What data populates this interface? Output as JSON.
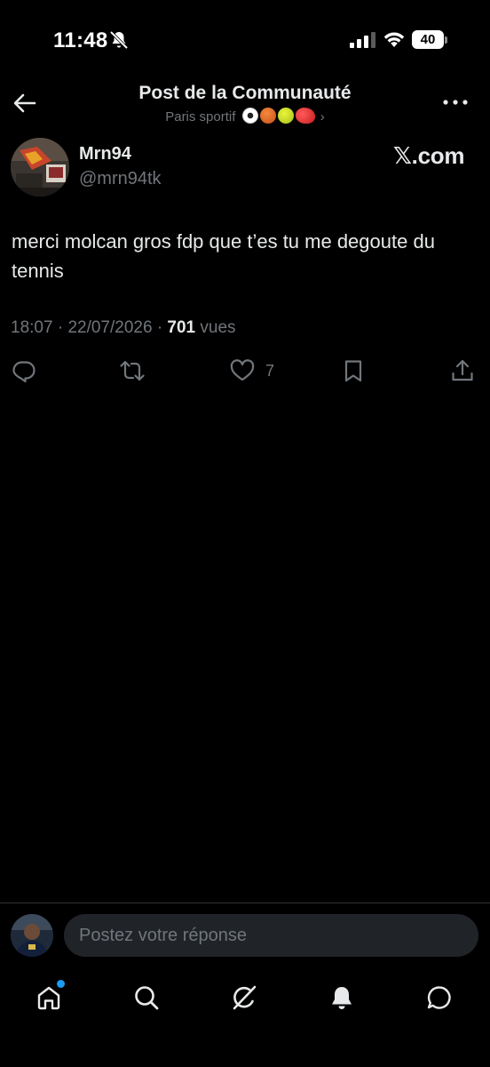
{
  "status_bar": {
    "time": "11:48",
    "battery": "40"
  },
  "header": {
    "title": "Post de la Communauté",
    "subtitle": "Paris sportif",
    "subtitle_emojis": [
      "soccer-ball",
      "basketball",
      "tennis-ball",
      "boxing-glove"
    ],
    "subtitle_chevron": "›"
  },
  "post": {
    "author_name": "Mrn94",
    "author_handle": "@mrn94tk",
    "watermark": "𝕏.com",
    "text": "merci molcan gros fdp que t’es tu me degoute du tennis",
    "time": "18:07",
    "date": "22/07/2026",
    "views_count": "701",
    "views_label": "vues",
    "like_count": "7"
  },
  "reply": {
    "placeholder": "Postez votre réponse"
  },
  "tabs": [
    "home",
    "search",
    "grok",
    "notifications",
    "messages"
  ],
  "colors": {
    "background": "#000000",
    "text": "#e7e9ea",
    "secondary": "#71767b",
    "accent": "#1d9bf0",
    "input_bg": "#202327"
  }
}
